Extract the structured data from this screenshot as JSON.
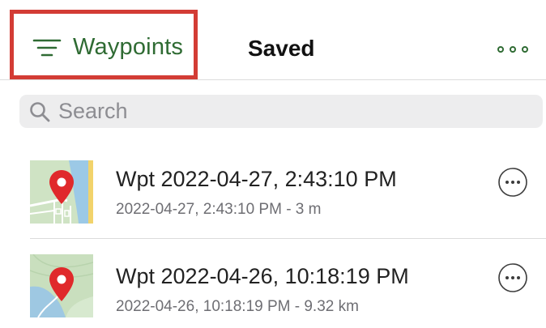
{
  "header": {
    "filter_label": "Waypoints",
    "title": "Saved",
    "filter_icon": "filter-lines-icon",
    "more_icon": "more-dots-icon"
  },
  "search": {
    "placeholder": "Search",
    "value": ""
  },
  "waypoints": [
    {
      "title": "Wpt 2022-04-27, 2:43:10 PM",
      "subtitle": "2022-04-27, 2:43:10 PM - 3 m",
      "thumbnail": "map-pin-thumbnail"
    },
    {
      "title": "Wpt 2022-04-26, 10:18:19 PM",
      "subtitle": "2022-04-26, 10:18:19 PM - 9.32 km",
      "thumbnail": "map-pin-thumbnail"
    }
  ],
  "colors": {
    "accent": "#2f6b33",
    "highlight": "#d33c35",
    "pin": "#e0292b"
  }
}
